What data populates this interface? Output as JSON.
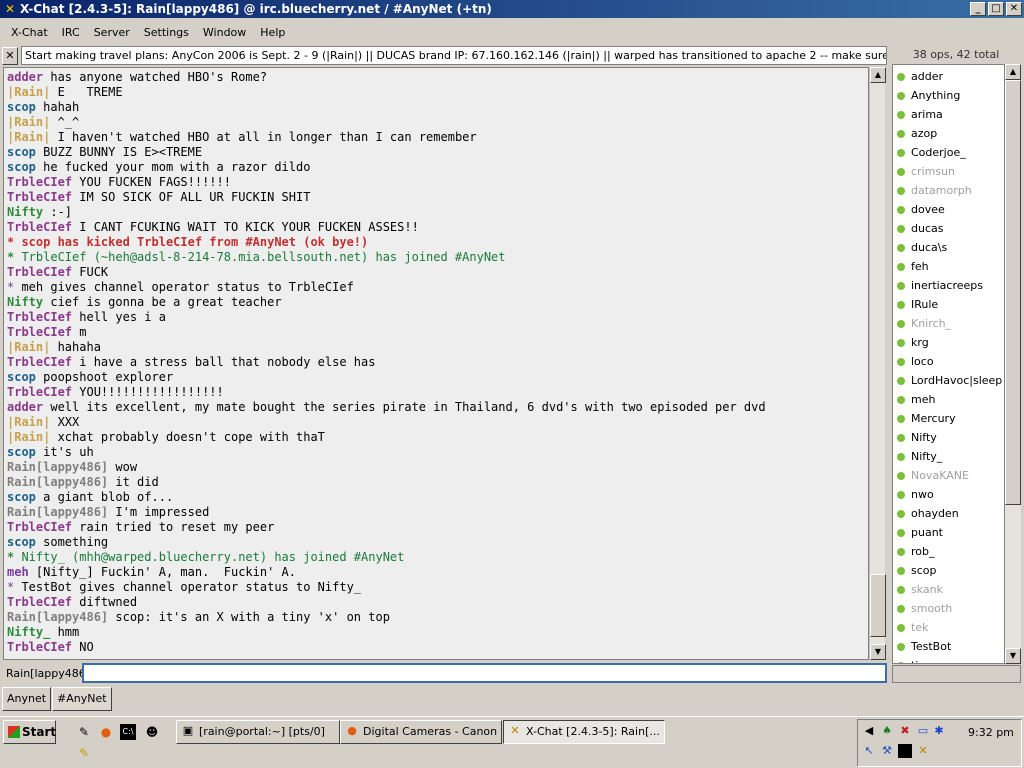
{
  "window": {
    "title": "X-Chat [2.4.3-5]: Rain[lappy486] @ irc.bluecherry.net / #AnyNet (+tn)"
  },
  "menu": [
    "X-Chat",
    "IRC",
    "Server",
    "Settings",
    "Window",
    "Help"
  ],
  "topic": "Start making travel plans: AnyCon 2006 is Sept. 2 - 9 (|Rain|) || DUCAS brand IP: 67.160.162.146 (|rain|) || warped has transitioned to apache 2 -- make sure your sites still work",
  "ops_count": "38 ops, 42 total",
  "messages": [
    {
      "nick": "adder",
      "cls": "n-adder",
      "text": "has anyone watched HBO's Rome?"
    },
    {
      "nick": "|Rain|",
      "cls": "n-rain",
      "text": "E   TREME"
    },
    {
      "nick": "scop",
      "cls": "n-scop",
      "text": "hahah"
    },
    {
      "nick": "|Rain|",
      "cls": "n-rain",
      "text": "^_^"
    },
    {
      "nick": "|Rain|",
      "cls": "n-rain",
      "text": "I haven't watched HBO at all in longer than I can remember"
    },
    {
      "nick": "scop",
      "cls": "n-scop",
      "text": "BUZZ BUNNY IS E><TREME"
    },
    {
      "nick": "scop",
      "cls": "n-scop",
      "text": "he fucked your mom with a razor dildo"
    },
    {
      "nick": "TrbleCIef",
      "cls": "n-trble",
      "text": "YOU FUCKEN FAGS!!!!!!"
    },
    {
      "nick": "TrbleCIef",
      "cls": "n-trble",
      "text": "IM SO SICK OF ALL UR FUCKIN SHIT"
    },
    {
      "nick": "Nifty",
      "cls": "n-nifty",
      "text": ":-]"
    },
    {
      "nick": "TrbleCIef",
      "cls": "n-trble",
      "text": "I CANT FCUKING WAIT TO KICK YOUR FUCKEN ASSES!!"
    },
    {
      "nick": "*",
      "cls": "kick",
      "text": "scop has kicked TrbleCIef from #AnyNet (ok bye!)"
    },
    {
      "nick": "*",
      "cls": "join",
      "text": "TrbleCIef (~heh@adsl-8-214-78.mia.bellsouth.net) has joined #AnyNet"
    },
    {
      "nick": "TrbleCIef",
      "cls": "n-trble",
      "text": "FUCK"
    },
    {
      "nick": "*",
      "cls": "mode",
      "text": "meh gives channel operator status to TrbleCIef"
    },
    {
      "nick": "Nifty",
      "cls": "n-nifty",
      "text": "cief is gonna be a great teacher"
    },
    {
      "nick": "TrbleCIef",
      "cls": "n-trble",
      "text": "hell yes i a"
    },
    {
      "nick": "TrbleCIef",
      "cls": "n-trble",
      "text": "m"
    },
    {
      "nick": "|Rain|",
      "cls": "n-rain",
      "text": "hahaha"
    },
    {
      "nick": "TrbleCIef",
      "cls": "n-trble",
      "text": "i have a stress ball that nobody else has"
    },
    {
      "nick": "scop",
      "cls": "n-scop",
      "text": "poopshoot explorer"
    },
    {
      "nick": "TrbleCIef",
      "cls": "n-trble",
      "text": "YOU!!!!!!!!!!!!!!!!!"
    },
    {
      "nick": "adder",
      "cls": "n-adder",
      "text": "well its excellent, my mate bought the series pirate in Thailand, 6 dvd's with two episoded per dvd"
    },
    {
      "nick": "|Rain|",
      "cls": "n-rain",
      "text": "XXX"
    },
    {
      "nick": "|Rain|",
      "cls": "n-rain",
      "text": "xchat probably doesn't cope with thaT"
    },
    {
      "nick": "scop",
      "cls": "n-scop",
      "text": "it's uh"
    },
    {
      "nick": "Rain[lappy486]",
      "cls": "n-self",
      "text": "wow"
    },
    {
      "nick": "Rain[lappy486]",
      "cls": "n-self",
      "text": "it did"
    },
    {
      "nick": "scop",
      "cls": "n-scop",
      "text": "a giant blob of..."
    },
    {
      "nick": "Rain[lappy486]",
      "cls": "n-self",
      "text": "I'm impressed"
    },
    {
      "nick": "TrbleCIef",
      "cls": "n-trble",
      "text": "rain tried to reset my peer"
    },
    {
      "nick": "scop",
      "cls": "n-scop",
      "text": "something"
    },
    {
      "nick": "*",
      "cls": "join",
      "text": "Nifty_ (mhh@warped.bluecherry.net) has joined #AnyNet"
    },
    {
      "nick": "meh",
      "cls": "n-meh",
      "text": "[Nifty_] Fuckin' A, man.  Fuckin' A."
    },
    {
      "nick": "*",
      "cls": "mode",
      "text": "TestBot gives channel operator status to Nifty_"
    },
    {
      "nick": "TrbleCIef",
      "cls": "n-trble",
      "text": "diftwned"
    },
    {
      "nick": "Rain[lappy486]",
      "cls": "n-self",
      "text": "scop: it's an X with a tiny 'x' on top"
    },
    {
      "nick": "Nifty_",
      "cls": "n-nifty",
      "text": "hmm"
    },
    {
      "nick": "TrbleCIef",
      "cls": "n-trble",
      "text": "NO"
    }
  ],
  "users": [
    {
      "name": "adder",
      "away": false
    },
    {
      "name": "Anything",
      "away": false
    },
    {
      "name": "arima",
      "away": false
    },
    {
      "name": "azop",
      "away": false
    },
    {
      "name": "Coderjoe_",
      "away": false
    },
    {
      "name": "crimsun",
      "away": true
    },
    {
      "name": "datamorph",
      "away": true
    },
    {
      "name": "dovee",
      "away": false
    },
    {
      "name": "ducas",
      "away": false
    },
    {
      "name": "duca\\s",
      "away": false
    },
    {
      "name": "feh",
      "away": false
    },
    {
      "name": "inertiacreeps",
      "away": false
    },
    {
      "name": "IRule",
      "away": false
    },
    {
      "name": "Knirch_",
      "away": true
    },
    {
      "name": "krg",
      "away": false
    },
    {
      "name": "loco",
      "away": false
    },
    {
      "name": "LordHavoc|sleep",
      "away": false
    },
    {
      "name": "meh",
      "away": false
    },
    {
      "name": "Mercury",
      "away": false
    },
    {
      "name": "Nifty",
      "away": false
    },
    {
      "name": "Nifty_",
      "away": false
    },
    {
      "name": "NovaKANE",
      "away": true
    },
    {
      "name": "nwo",
      "away": false
    },
    {
      "name": "ohayden",
      "away": false
    },
    {
      "name": "puant",
      "away": false
    },
    {
      "name": "rob_",
      "away": false
    },
    {
      "name": "scop",
      "away": false
    },
    {
      "name": "skank",
      "away": true
    },
    {
      "name": "smooth",
      "away": true
    },
    {
      "name": "tek",
      "away": true
    },
    {
      "name": "TestBot",
      "away": false
    },
    {
      "name": "timm",
      "away": false
    }
  ],
  "input": {
    "nick": "Rain[lappy486]",
    "value": ""
  },
  "tabs": [
    "Anynet",
    "#AnyNet"
  ],
  "taskbar": {
    "start": "Start",
    "tasks": [
      "[rain@portal:~] [pts/0]",
      "Digital Cameras - Canon P...",
      "X-Chat [2.4.3-5]: Rain[..."
    ],
    "clock": "9:32 pm"
  }
}
